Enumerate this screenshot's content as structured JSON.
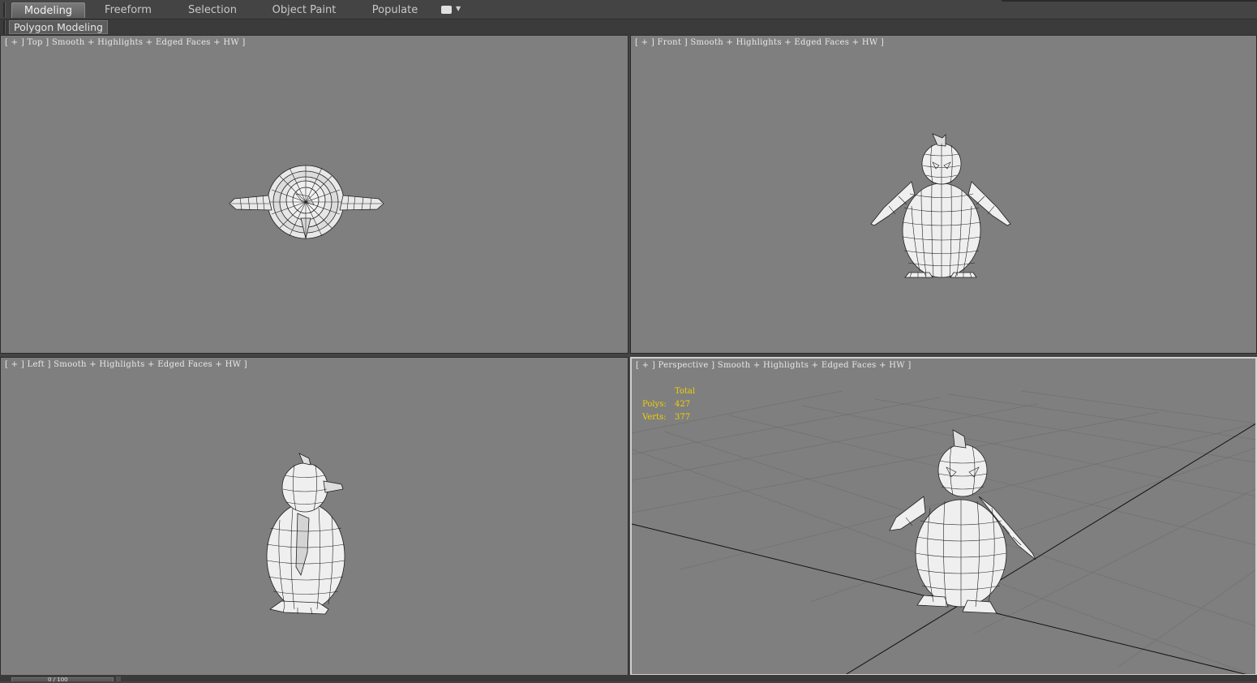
{
  "ribbon": {
    "tabs": [
      {
        "label": "Modeling",
        "active": true
      },
      {
        "label": "Freeform",
        "active": false
      },
      {
        "label": "Selection",
        "active": false
      },
      {
        "label": "Object Paint",
        "active": false
      },
      {
        "label": "Populate",
        "active": false
      }
    ],
    "panel_label": "Polygon Modeling"
  },
  "viewports": {
    "top": {
      "label": "[ + ] Top ] Smooth + Highlights + Edged Faces + HW ]"
    },
    "front": {
      "label": "[ + ] Front ] Smooth + Highlights + Edged Faces + HW ]"
    },
    "left": {
      "label": "[ + ] Left ] Smooth + Highlights + Edged Faces + HW ]"
    },
    "perspective": {
      "label": "[ + ] Perspective ] Smooth + Highlights + Edged Faces + HW ]"
    }
  },
  "stats": {
    "header": "Total",
    "polys_label": "Polys:",
    "polys_value": "427",
    "verts_label": "Verts:",
    "verts_value": "377"
  },
  "timeslider": {
    "label": "0 / 100"
  },
  "colors": {
    "viewport_bg": "#7f7f7f",
    "ui_bg": "#444444",
    "stats_text": "#f0d000",
    "active_border": "#d0d0d0"
  }
}
